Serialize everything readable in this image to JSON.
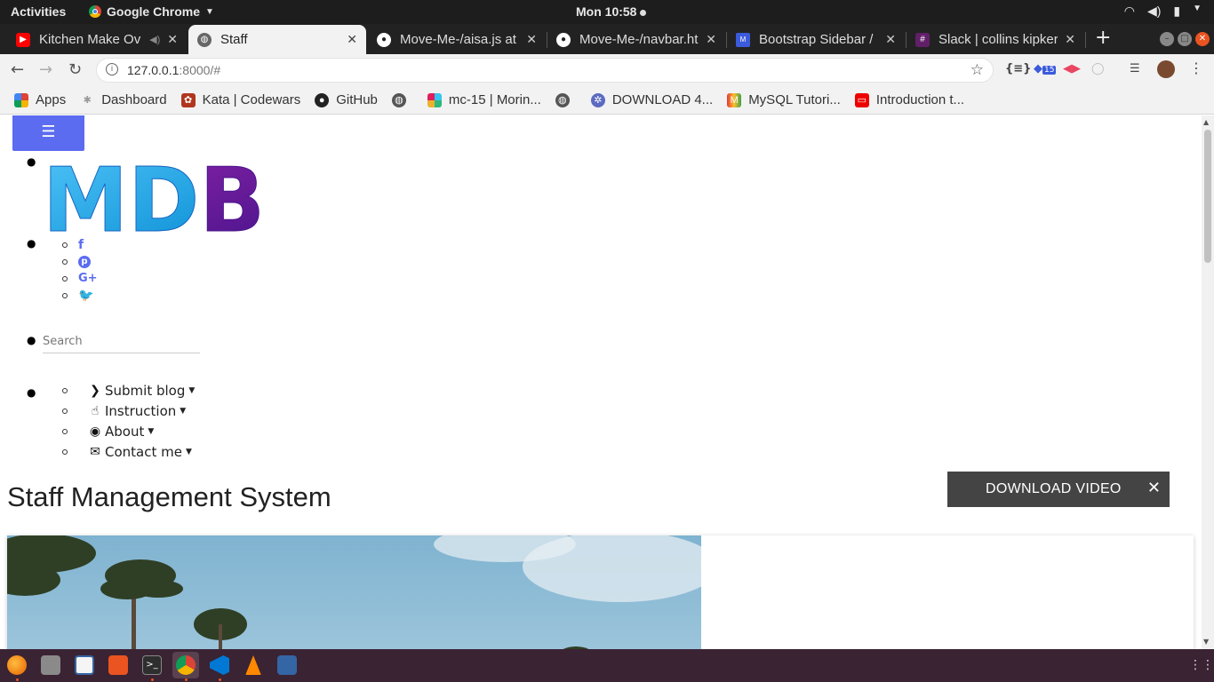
{
  "system_bar": {
    "activities": "Activities",
    "app_name": "Google Chrome",
    "clock": "Mon 10:58"
  },
  "tabs": [
    {
      "title": "Kitchen Make Ov",
      "favicon": "youtube-icon",
      "color": "#ff0000"
    },
    {
      "title": "Staff",
      "favicon": "globe-icon",
      "color": "#555555",
      "active": true
    },
    {
      "title": "Move-Me-/aisa.js at",
      "favicon": "github-icon",
      "color": "#ffffff"
    },
    {
      "title": "Move-Me-/navbar.ht",
      "favicon": "github-icon",
      "color": "#ffffff"
    },
    {
      "title": "Bootstrap Sidebar /",
      "favicon": "mdb-icon",
      "color": "#3b5bdb"
    },
    {
      "title": "Slack | collins kipker",
      "favicon": "slack-icon",
      "color": "#611f69"
    }
  ],
  "address_bar": {
    "url_host": "127.0.0.1",
    "url_path": ":8000/#"
  },
  "bookmarks": [
    {
      "label": "Apps",
      "icon": "apps-grid-icon"
    },
    {
      "label": "Dashboard",
      "icon": "dashboard-icon"
    },
    {
      "label": "Kata | Codewars",
      "icon": "codewars-icon"
    },
    {
      "label": "GitHub",
      "icon": "github-icon"
    },
    {
      "label": "",
      "icon": "globe-icon"
    },
    {
      "label": "mc-15 | Morin...",
      "icon": "slack-icon"
    },
    {
      "label": "",
      "icon": "globe-icon"
    },
    {
      "label": "DOWNLOAD 4...",
      "icon": "film-reel-icon"
    },
    {
      "label": "MySQL Tutori...",
      "icon": "mysql-icon"
    },
    {
      "label": "Introduction t...",
      "icon": "oracle-icon"
    }
  ],
  "page": {
    "logo_text": "MDB",
    "social_icons": [
      "facebook-icon",
      "pinterest-icon",
      "google-plus-icon",
      "twitter-icon"
    ],
    "search_placeholder": "Search",
    "menu": [
      {
        "label": "Submit blog",
        "icon": "chevron-right-icon"
      },
      {
        "label": "Instruction",
        "icon": "hand-pointer-icon"
      },
      {
        "label": "About",
        "icon": "eye-icon"
      },
      {
        "label": "Contact me",
        "icon": "envelope-icon"
      }
    ],
    "heading": "Staff Management System"
  },
  "download_button": {
    "label": "DOWNLOAD VIDEO"
  },
  "colors": {
    "accent": "#5b6cf0",
    "logo_m": "#29b6f6",
    "logo_b": "#7b1fa2",
    "dock": "#3a2333"
  }
}
